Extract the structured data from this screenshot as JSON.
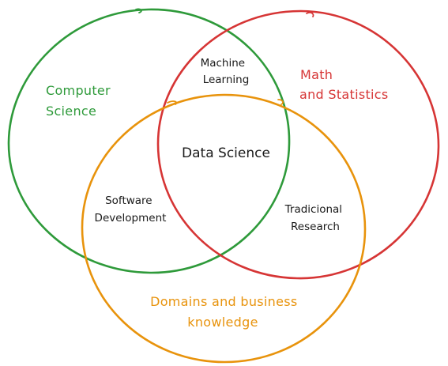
{
  "diagram": {
    "sets": [
      {
        "id": "cs",
        "lines": [
          "Computer",
          "Science"
        ],
        "color": "#2e9a3a"
      },
      {
        "id": "math",
        "lines": [
          "Math",
          "and Statistics"
        ],
        "color": "#d63535"
      },
      {
        "id": "dom",
        "lines": [
          "Domains and business",
          "knowledge"
        ],
        "color": "#e8930c"
      }
    ],
    "regions": {
      "ml": [
        "Machine",
        "Learning"
      ],
      "sd": [
        "Software",
        "Development"
      ],
      "tr": [
        "Tradicional",
        "Research"
      ],
      "center": "Data Science"
    }
  }
}
